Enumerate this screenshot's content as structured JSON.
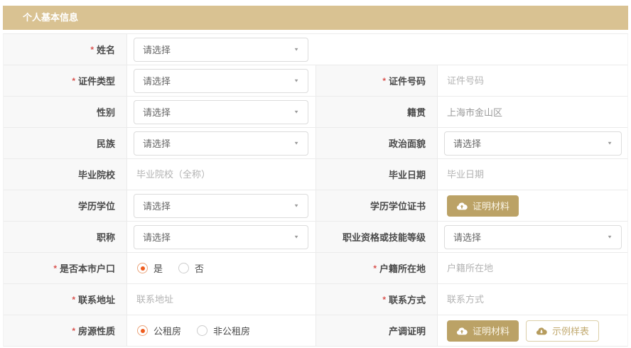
{
  "header": {
    "title": "个人基本信息"
  },
  "required_marker": "*",
  "icons": {
    "caret": "▼"
  },
  "colors": {
    "header_bg": "#d9c292",
    "button_tan": "#bba266",
    "required_red": "#d9534f",
    "radio_selected": "#ef5c1e",
    "label_cell_bg": "#f8f8f8"
  },
  "fields": {
    "name": {
      "label": "姓名",
      "required": true,
      "placeholder": "请选择"
    },
    "id_type": {
      "label": "证件类型",
      "required": true,
      "placeholder": "请选择"
    },
    "id_number": {
      "label": "证件号码",
      "required": true,
      "placeholder": "证件号码"
    },
    "gender": {
      "label": "性别",
      "placeholder": "请选择"
    },
    "native_place": {
      "label": "籍贯",
      "value": "上海市金山区"
    },
    "ethnicity": {
      "label": "民族",
      "placeholder": "请选择"
    },
    "political_status": {
      "label": "政治面貌",
      "placeholder": "请选择"
    },
    "graduation_school": {
      "label": "毕业院校",
      "placeholder": "毕业院校（全称）"
    },
    "graduation_date": {
      "label": "毕业日期",
      "placeholder": "毕业日期"
    },
    "education_degree": {
      "label": "学历学位",
      "placeholder": "请选择"
    },
    "degree_certificate": {
      "label": "学历学位证书",
      "upload_label": "证明材料"
    },
    "job_title": {
      "label": "职称",
      "placeholder": "请选择"
    },
    "vocational_level": {
      "label": "职业资格或技能等级",
      "placeholder": "请选择"
    },
    "local_household": {
      "label": "是否本市户口",
      "required": true,
      "options": [
        "是",
        "否"
      ],
      "selected": "是"
    },
    "household_location": {
      "label": "户籍所在地",
      "required": true,
      "placeholder": "户籍所在地"
    },
    "contact_address": {
      "label": "联系地址",
      "required": true,
      "placeholder": "联系地址"
    },
    "contact_method": {
      "label": "联系方式",
      "required": true,
      "placeholder": "联系方式"
    },
    "housing_type": {
      "label": "房源性质",
      "required": true,
      "options": [
        "公租房",
        "非公租房"
      ],
      "selected": "公租房"
    },
    "property_certificate": {
      "label": "产调证明",
      "upload_label": "证明材料",
      "sample_label": "示例样表"
    }
  }
}
